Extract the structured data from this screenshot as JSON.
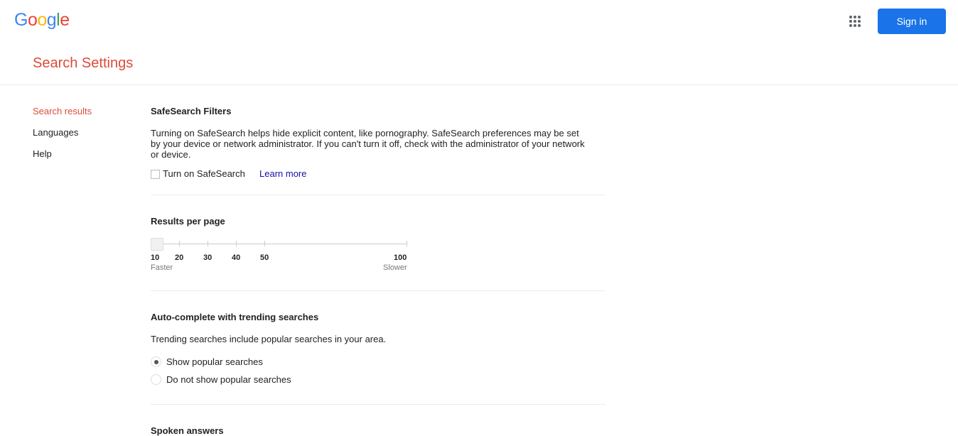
{
  "header": {
    "logo": "Google",
    "logo_colors": [
      "#4285f4",
      "#ea4335",
      "#fbbc05",
      "#4285f4",
      "#34a853",
      "#ea4335"
    ],
    "apps_icon": "apps-grid-icon",
    "sign_in": "Sign in"
  },
  "page_title": "Search Settings",
  "sidebar": {
    "items": [
      {
        "label": "Search results",
        "selected": true
      },
      {
        "label": "Languages"
      },
      {
        "label": "Help"
      }
    ]
  },
  "safesearch": {
    "title": "SafeSearch Filters",
    "description": "Turning on SafeSearch helps hide explicit content, like pornography. SafeSearch preferences may be set by your device or network administrator. If you can't turn it off, check with the administrator of your network or device.",
    "checkbox_label": "Turn on SafeSearch",
    "checked": false,
    "learn_more": "Learn more"
  },
  "results_per_page": {
    "title": "Results per page",
    "value": 10,
    "min": 10,
    "max": 100,
    "ticks": [
      "10",
      "20",
      "30",
      "40",
      "50",
      "100"
    ],
    "faster": "Faster",
    "slower": "Slower"
  },
  "autocomplete": {
    "title": "Auto-complete with trending searches",
    "description": "Trending searches include popular searches in your area.",
    "options": [
      {
        "label": "Show popular searches",
        "selected": true
      },
      {
        "label": "Do not show popular searches",
        "selected": false
      }
    ]
  },
  "spoken": {
    "title": "Spoken answers"
  }
}
